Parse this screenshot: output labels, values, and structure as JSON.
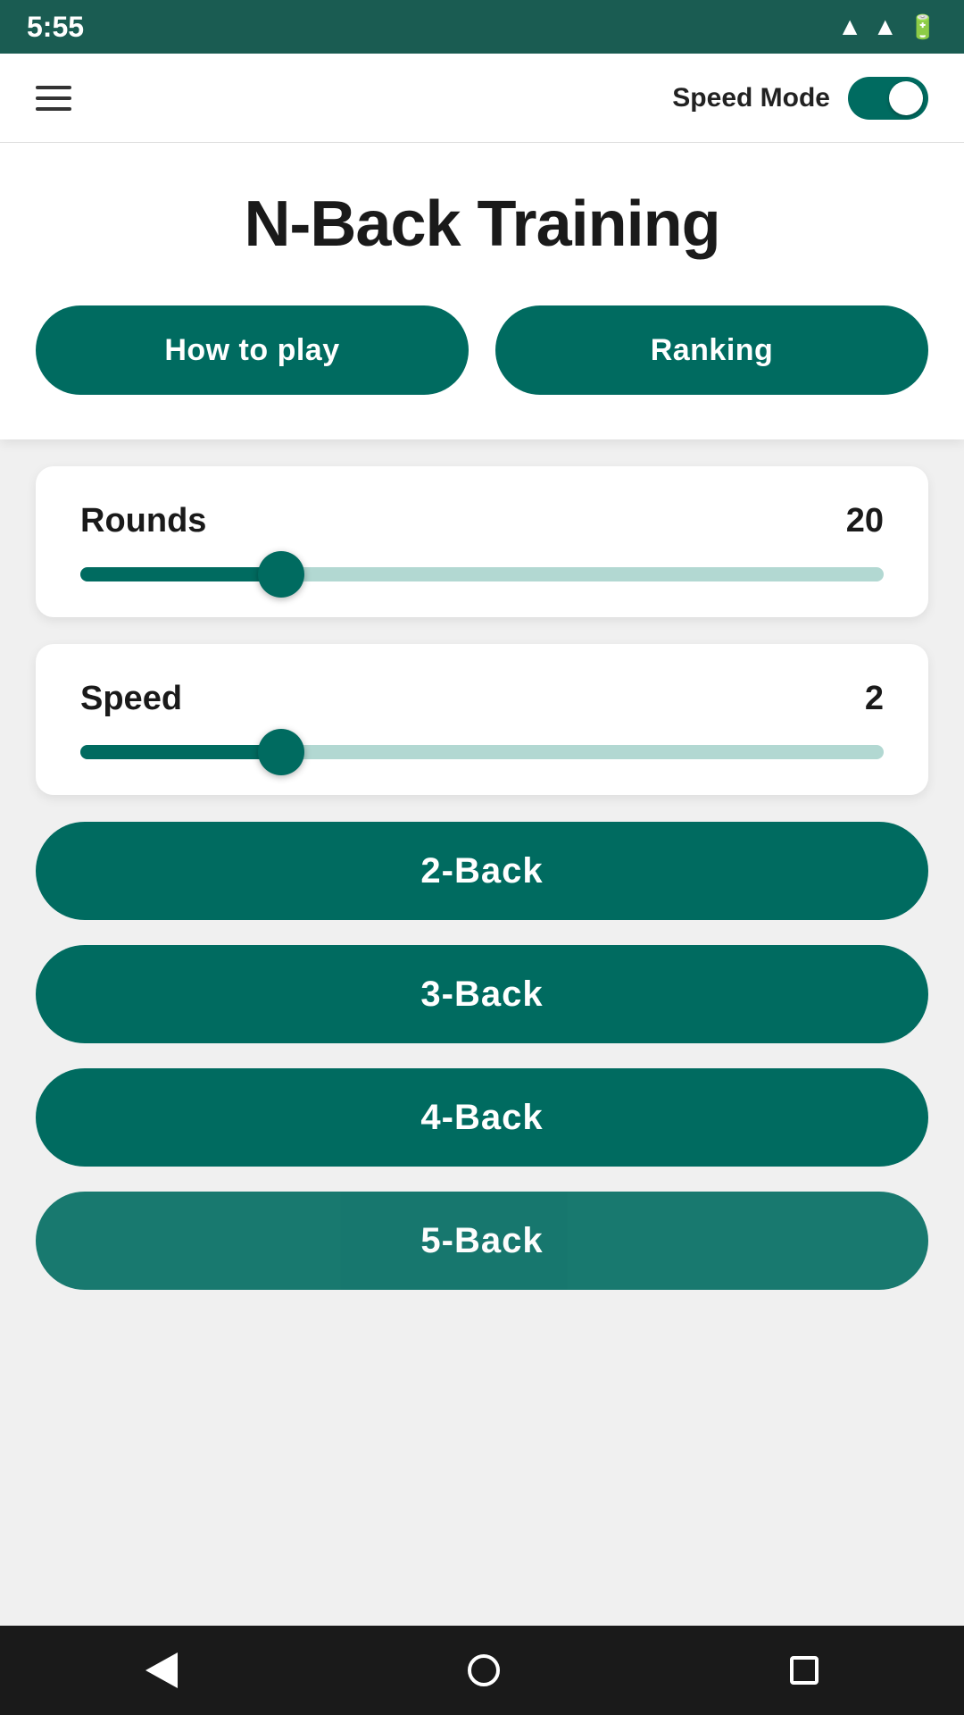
{
  "statusBar": {
    "time": "5:55"
  },
  "topBar": {
    "speedModeLabel": "Speed Mode",
    "toggleEnabled": true
  },
  "header": {
    "title": "N-Back Training",
    "howToPlayLabel": "How to play",
    "rankingLabel": "Ranking"
  },
  "roundsSlider": {
    "label": "Rounds",
    "value": "20",
    "fillPercent": 25,
    "thumbPercent": 25
  },
  "speedSlider": {
    "label": "Speed",
    "value": "2",
    "fillPercent": 25,
    "thumbPercent": 25
  },
  "backButtons": [
    {
      "label": "2-Back"
    },
    {
      "label": "3-Back"
    },
    {
      "label": "4-Back"
    },
    {
      "label": "5-Back"
    }
  ],
  "colors": {
    "primary": "#006b60",
    "statusBar": "#1a5c52",
    "navBar": "#1a1a1a"
  }
}
